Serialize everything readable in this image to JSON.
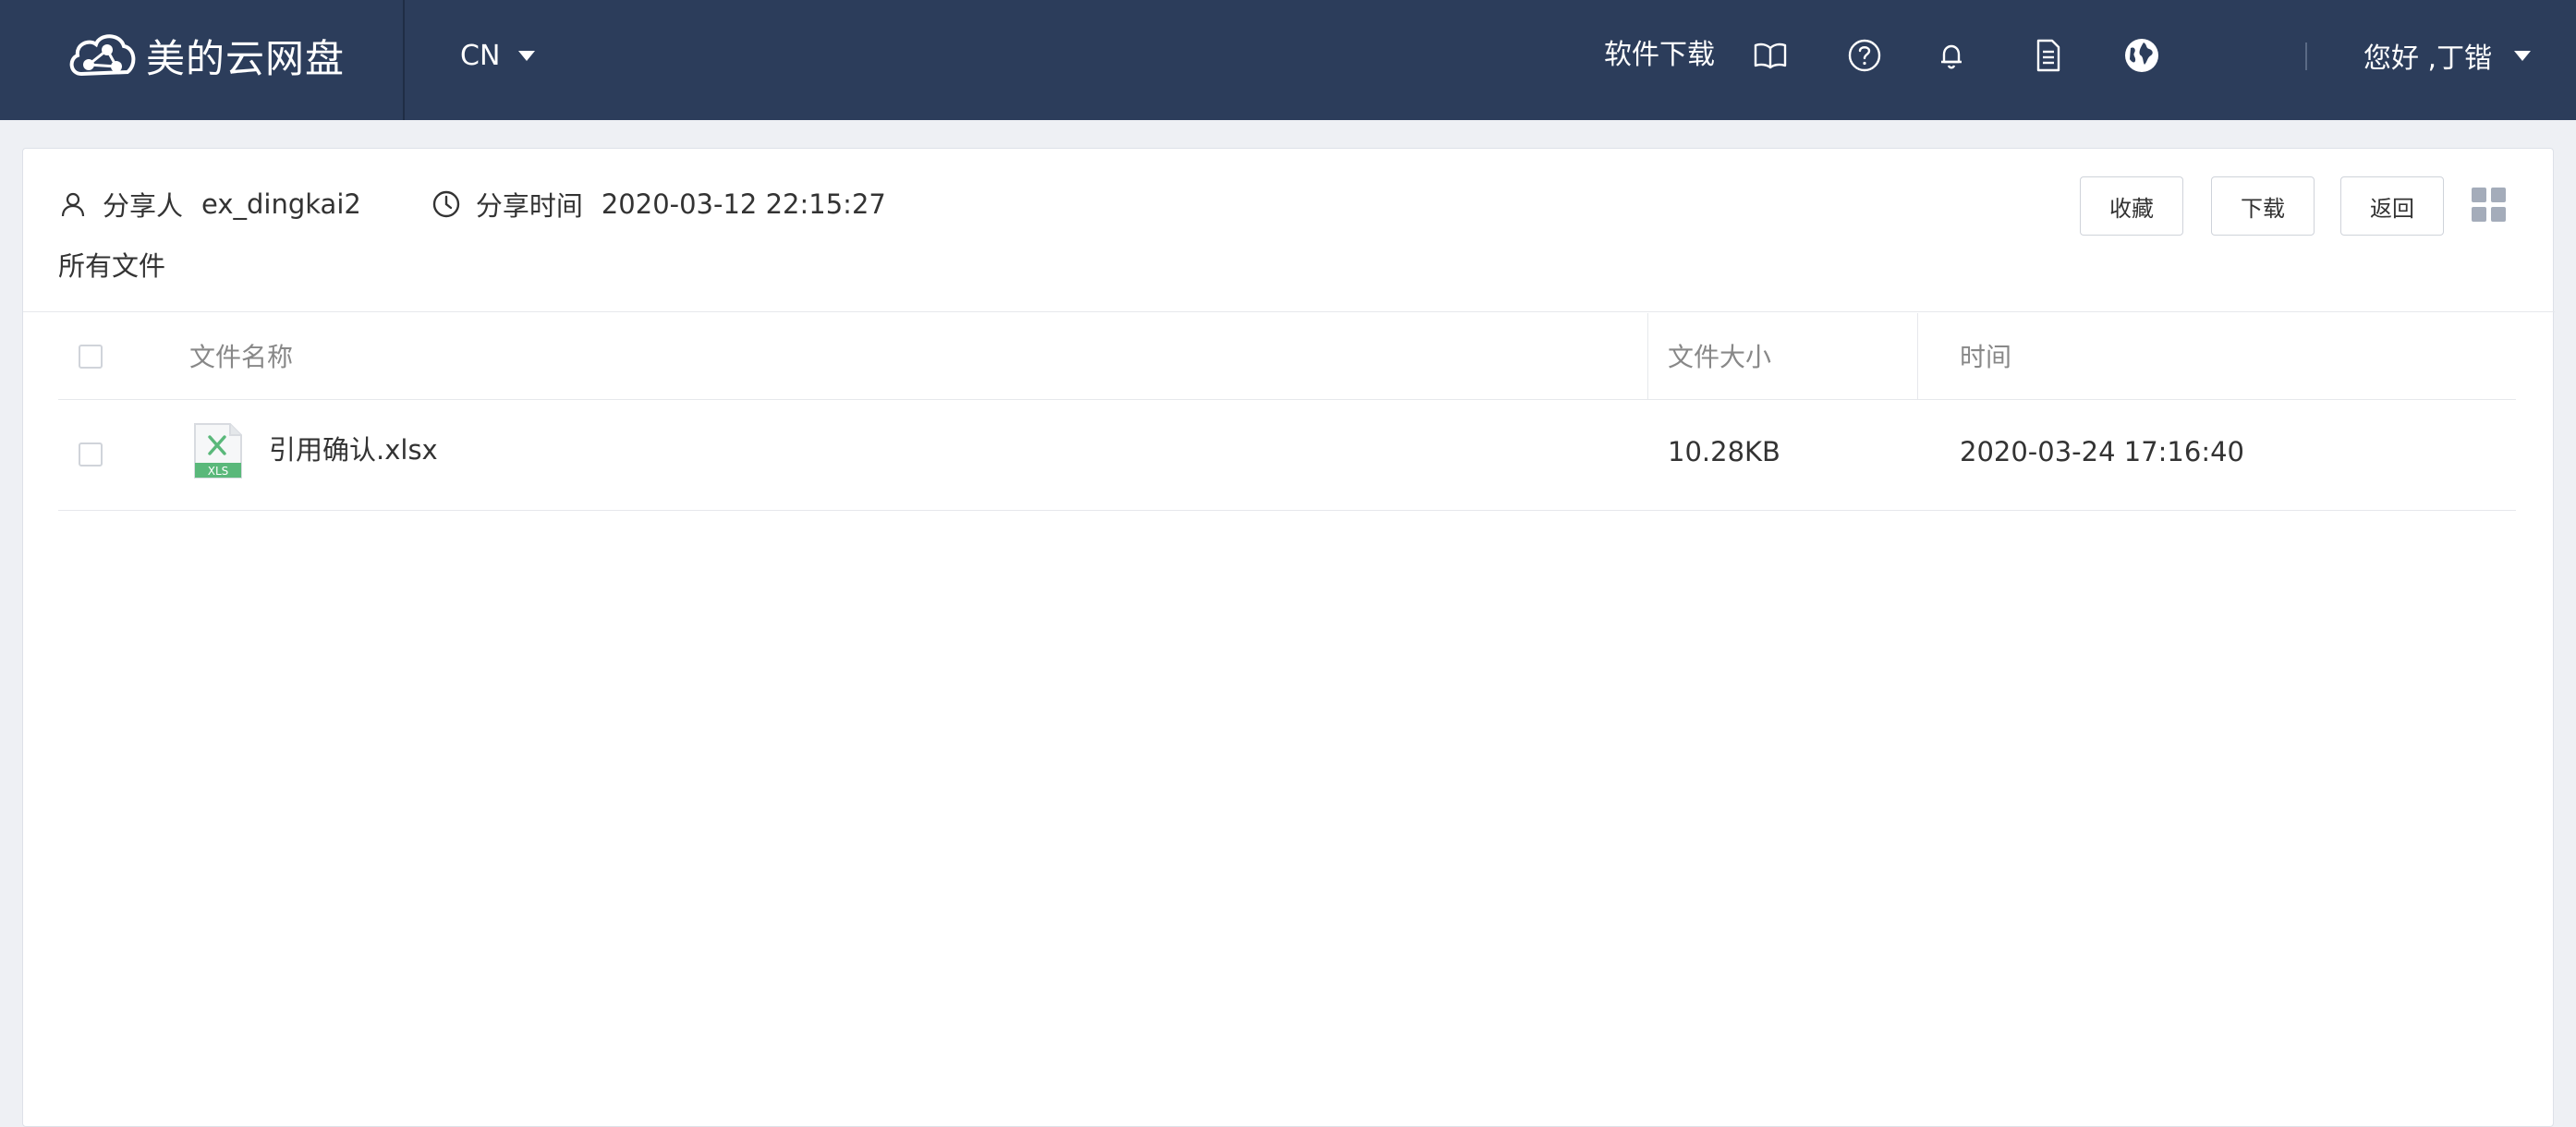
{
  "header": {
    "brand": "美的云网盘",
    "language": "CN",
    "software_download": "软件下载",
    "icons": [
      "book-icon",
      "help-icon",
      "bell-icon",
      "document-icon",
      "globe-icon"
    ],
    "greeting": "您好 ,丁锴"
  },
  "share_info": {
    "sharer_label": "分享人",
    "sharer": "ex_dingkai2",
    "time_label": "分享时间",
    "time": "2020-03-12 22:15:27",
    "breadcrumb": "所有文件"
  },
  "actions": {
    "favorite": "收藏",
    "download": "下载",
    "back": "返回"
  },
  "table": {
    "columns": [
      "文件名称",
      "文件大小",
      "时间"
    ],
    "rows": [
      {
        "name": "引用确认.xlsx",
        "size": "10.28KB",
        "time": "2020-03-24 17:16:40",
        "type": "XLS"
      }
    ]
  },
  "colors": {
    "header_bg": "#2c3d5b",
    "page_bg": "#eef0f4",
    "excel_green": "#5ab87a"
  }
}
